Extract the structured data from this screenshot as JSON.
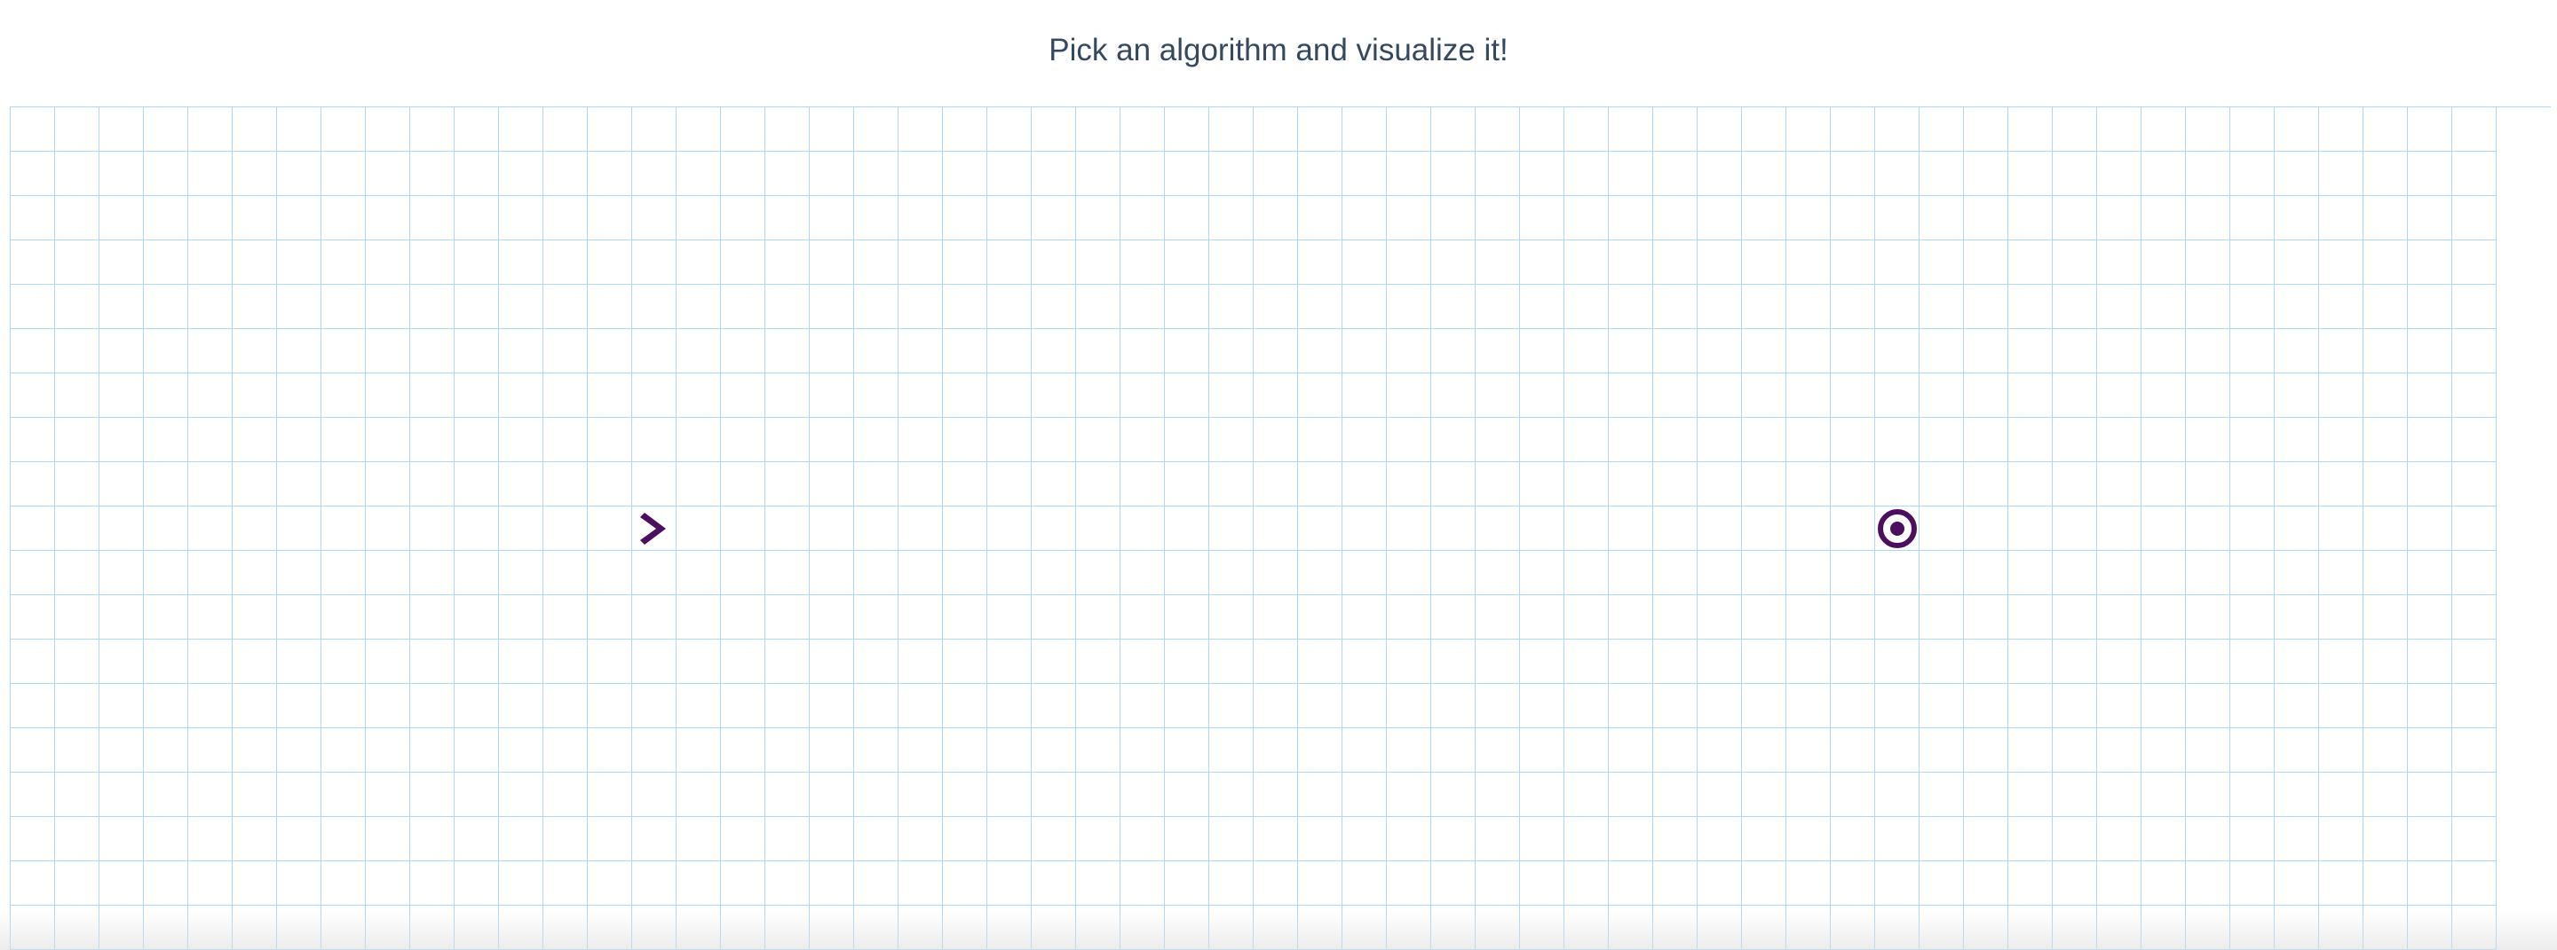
{
  "header": {
    "title": "Pick an algorithm and visualize it!"
  },
  "grid": {
    "cols": 56,
    "rows": 19,
    "cell_border_color": "#afd8f8",
    "start": {
      "row": 9,
      "col": 14,
      "icon": "start-chevron-right-icon"
    },
    "target": {
      "row": 9,
      "col": 42,
      "icon": "target-bullseye-icon"
    },
    "node_icon_color": "#4b0f5d"
  }
}
